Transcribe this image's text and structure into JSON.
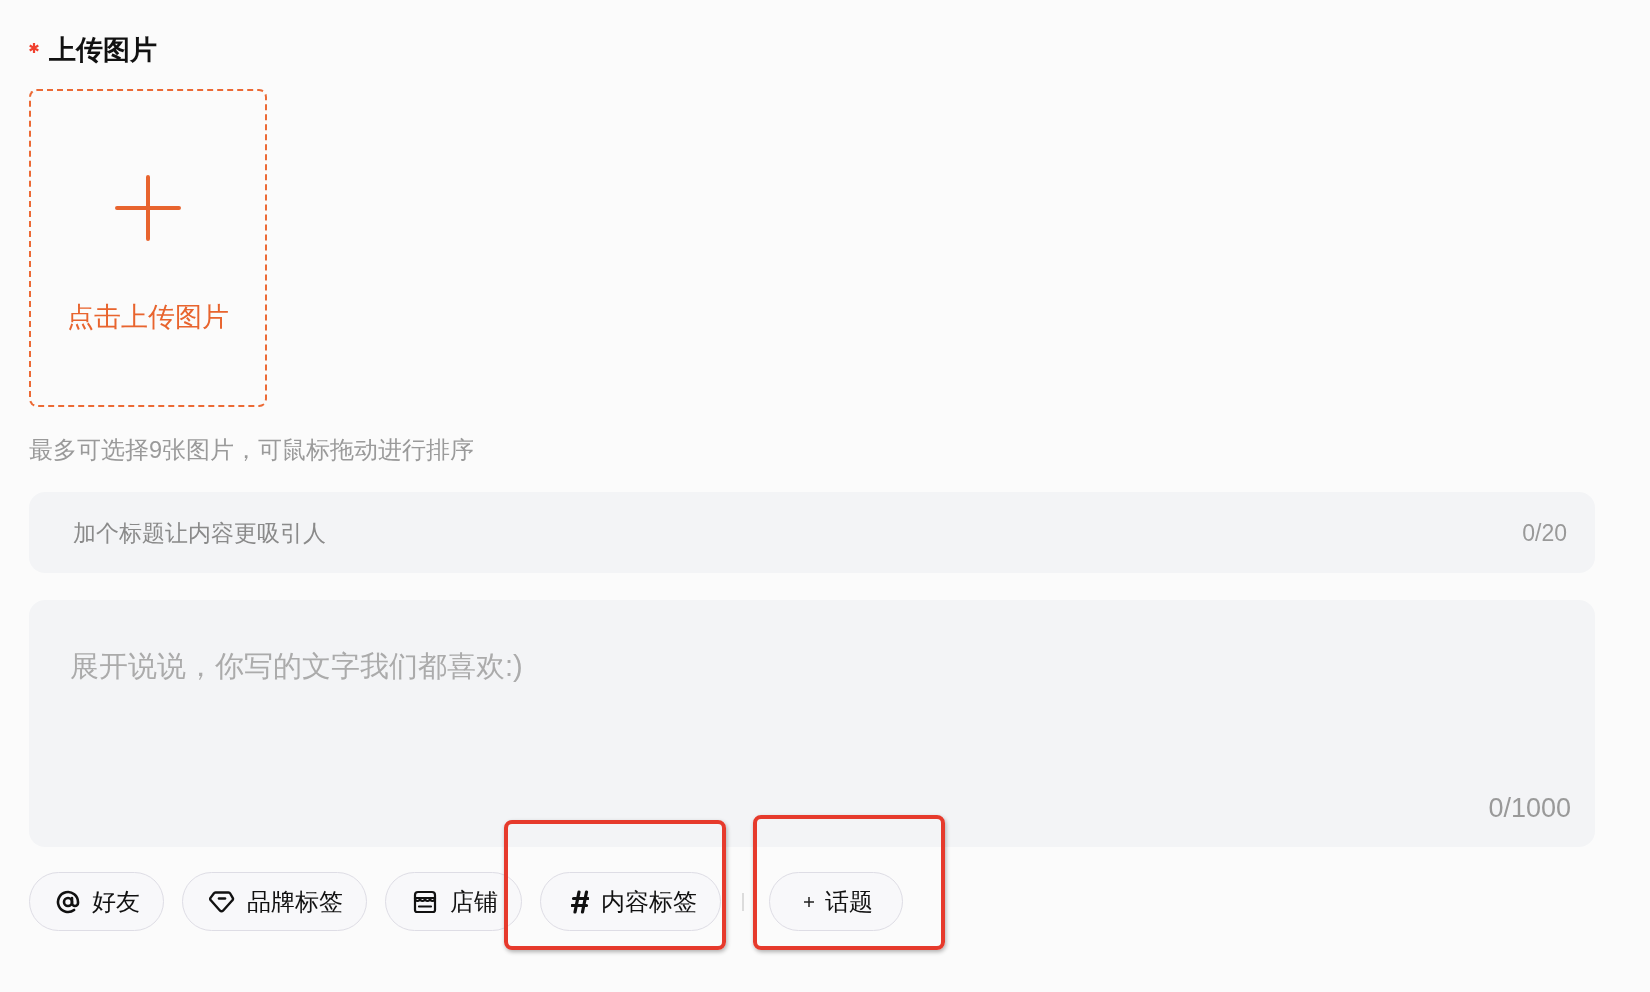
{
  "upload": {
    "label": "上传图片",
    "required": true,
    "button_text": "点击上传图片",
    "hint": "最多可选择9张图片，可鼠标拖动进行排序"
  },
  "title_field": {
    "placeholder": "加个标题让内容更吸引人",
    "counter": "0/20"
  },
  "body_field": {
    "placeholder": "展开说说，你写的文字我们都喜欢:)",
    "counter": "0/1000"
  },
  "chips": [
    {
      "kind": "mention",
      "label": "好友",
      "highlighted": false
    },
    {
      "kind": "brand",
      "label": "品牌标签",
      "highlighted": false
    },
    {
      "kind": "store",
      "label": "店铺",
      "highlighted": false
    },
    {
      "kind": "tag",
      "label": "内容标签",
      "highlighted": true
    },
    {
      "kind": "topic",
      "label": "话题",
      "highlighted": true
    }
  ]
}
